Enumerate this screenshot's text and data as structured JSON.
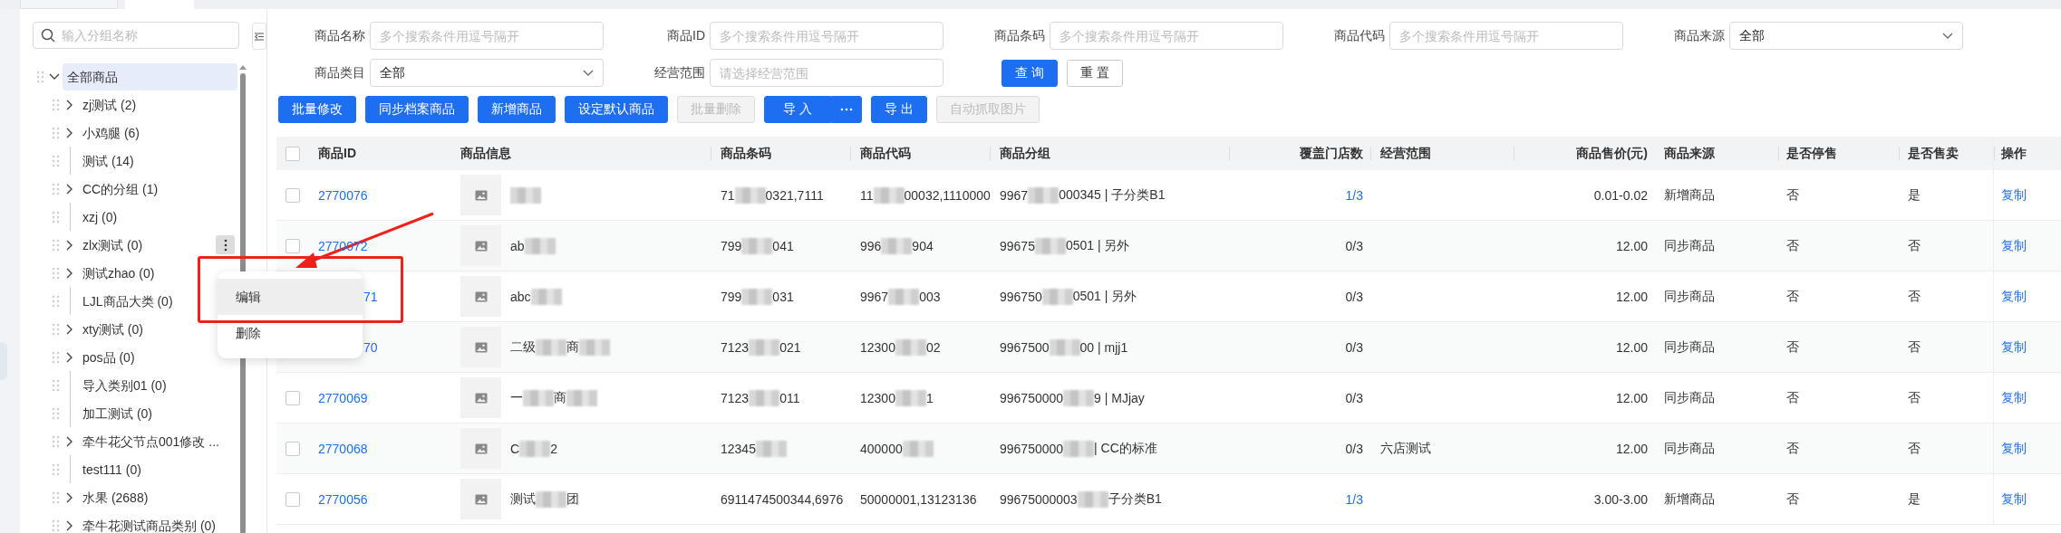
{
  "top_tabs": [
    {
      "selected": false
    },
    {
      "selected": true
    }
  ],
  "sidebar": {
    "search": {
      "placeholder": "输入分组名称"
    },
    "tree": [
      {
        "label": "全部商品",
        "kind": "group",
        "expanded": true,
        "selected": true,
        "menu_open": false,
        "children": [
          {
            "label": "zj测试 (2)",
            "kind": "group",
            "expanded": false,
            "selected": false,
            "menu_open": false
          },
          {
            "label": "小鸡腿 (6)",
            "kind": "group",
            "expanded": false,
            "selected": false,
            "menu_open": false
          },
          {
            "label": "测试 (14)",
            "kind": "leaf",
            "selected": false,
            "menu_open": false
          },
          {
            "label": "CC的分组 (1)",
            "kind": "group",
            "expanded": false,
            "selected": false,
            "menu_open": false
          },
          {
            "label": "xzj (0)",
            "kind": "leaf",
            "selected": false,
            "menu_open": false
          },
          {
            "label": "zlx测试 (0)",
            "kind": "group",
            "expanded": false,
            "selected": false,
            "menu_open": true
          },
          {
            "label": "测试zhao (0)",
            "kind": "group",
            "expanded": false,
            "selected": false,
            "menu_open": false
          },
          {
            "label": "LJL商品大类 (0)",
            "kind": "leaf",
            "selected": false,
            "menu_open": false
          },
          {
            "label": "xty测试 (0)",
            "kind": "group",
            "expanded": false,
            "selected": false,
            "menu_open": false
          },
          {
            "label": "pos品 (0)",
            "kind": "group",
            "expanded": false,
            "selected": false,
            "menu_open": false
          },
          {
            "label": "导入类别01 (0)",
            "kind": "leaf",
            "selected": false,
            "menu_open": false
          },
          {
            "label": "加工测试 (0)",
            "kind": "leaf",
            "selected": false,
            "menu_open": false
          },
          {
            "label": "牵牛花父节点001修改 ...",
            "kind": "group",
            "expanded": false,
            "selected": false,
            "menu_open": false
          },
          {
            "label": "test111 (0)",
            "kind": "leaf",
            "selected": false,
            "menu_open": false
          },
          {
            "label": "水果 (2688)",
            "kind": "group",
            "expanded": false,
            "selected": false,
            "menu_open": false
          },
          {
            "label": "牵牛花测试商品类别 (0)",
            "kind": "group",
            "expanded": false,
            "selected": false,
            "menu_open": false
          }
        ]
      }
    ],
    "context_menu": [
      {
        "label": "编辑",
        "hovered": true
      },
      {
        "label": "删除",
        "hovered": false
      }
    ]
  },
  "filter_rows": [
    [
      {
        "label": "商品名称",
        "kind": "input",
        "placeholder": "多个搜索条件用逗号隔开"
      },
      {
        "label": "商品ID",
        "kind": "input",
        "placeholder": "多个搜索条件用逗号隔开"
      },
      {
        "label": "商品条码",
        "kind": "input",
        "placeholder": "多个搜索条件用逗号隔开"
      },
      {
        "label": "商品代码",
        "kind": "input",
        "placeholder": "多个搜索条件用逗号隔开"
      },
      {
        "label": "商品来源",
        "kind": "select",
        "value": "全部"
      }
    ],
    [
      {
        "label": "商品类目",
        "kind": "select",
        "value": "全部"
      },
      {
        "label": "经营范围",
        "kind": "input",
        "placeholder": "请选择经营范围"
      }
    ]
  ],
  "filter_buttons": [
    {
      "label": "查 询",
      "kind": "primary"
    },
    {
      "label": "重 置",
      "kind": "default"
    }
  ],
  "toolbar": [
    {
      "label": "批量修改",
      "kind": "primary",
      "disabled": false
    },
    {
      "label": "同步档案商品",
      "kind": "primary",
      "disabled": false
    },
    {
      "label": "新增商品",
      "kind": "primary",
      "disabled": false
    },
    {
      "label": "设定默认商品",
      "kind": "primary",
      "disabled": false
    },
    {
      "label": "批量删除",
      "kind": "primary",
      "disabled": true
    },
    {
      "label": "导 入",
      "kind": "split",
      "disabled": false
    },
    {
      "label": "导 出",
      "kind": "primary",
      "disabled": false
    },
    {
      "label": "自动抓取图片",
      "kind": "primary",
      "disabled": true
    }
  ],
  "table": {
    "all_checked": false,
    "columns": [
      "商品ID",
      "商品信息",
      "商品条码",
      "商品代码",
      "商品分组",
      "覆盖门店数",
      "经营范围",
      "商品售价(元)",
      "商品来源",
      "是否停售",
      "是否售卖",
      "操作"
    ],
    "rows": [
      {
        "checked": false,
        "id": "2770076",
        "covered": false,
        "info": [
          {
            "kind": "blur"
          }
        ],
        "barcode": [
          {
            "kind": "text",
            "text": "71"
          },
          {
            "kind": "blur"
          },
          {
            "kind": "text",
            "text": "0321,7111"
          }
        ],
        "code": [
          {
            "kind": "text",
            "text": "11"
          },
          {
            "kind": "blur"
          },
          {
            "kind": "text",
            "text": "00032,1110000"
          }
        ],
        "group": [
          {
            "kind": "text",
            "text": "9967"
          },
          {
            "kind": "blur"
          },
          {
            "kind": "text",
            "text": "000345 | 子分类B1"
          }
        ],
        "stores": "1/3",
        "stores_link": true,
        "price": "0.01-0.02",
        "source": "新增商品",
        "stopped": "否",
        "on_sale": "是",
        "action": "复制"
      },
      {
        "checked": false,
        "id": "2770072",
        "covered": false,
        "info": [
          {
            "kind": "text",
            "text": "ab"
          },
          {
            "kind": "blur"
          }
        ],
        "barcode": [
          {
            "kind": "text",
            "text": "799"
          },
          {
            "kind": "blur"
          },
          {
            "kind": "text",
            "text": "041"
          }
        ],
        "code": [
          {
            "kind": "text",
            "text": "996"
          },
          {
            "kind": "blur"
          },
          {
            "kind": "text",
            "text": "904"
          }
        ],
        "group": [
          {
            "kind": "text",
            "text": "99675"
          },
          {
            "kind": "blur"
          },
          {
            "kind": "text",
            "text": "0501 | 另外"
          }
        ],
        "stores": "0/3",
        "stores_link": false,
        "price": "12.00",
        "source": "同步商品",
        "stopped": "否",
        "on_sale": "否",
        "action": "复制"
      },
      {
        "id": "71",
        "covered": true,
        "info": [
          {
            "kind": "text",
            "text": "abc"
          },
          {
            "kind": "blur"
          }
        ],
        "barcode": [
          {
            "kind": "text",
            "text": "799"
          },
          {
            "kind": "blur"
          },
          {
            "kind": "text",
            "text": "031"
          }
        ],
        "code": [
          {
            "kind": "text",
            "text": "9967"
          },
          {
            "kind": "blur"
          },
          {
            "kind": "text",
            "text": "003"
          }
        ],
        "group": [
          {
            "kind": "text",
            "text": "996750"
          },
          {
            "kind": "blur"
          },
          {
            "kind": "text",
            "text": "0501 | 另外"
          }
        ],
        "stores": "0/3",
        "stores_link": false,
        "price": "12.00",
        "source": "同步商品",
        "stopped": "否",
        "on_sale": "否",
        "action": "复制"
      },
      {
        "id": "70",
        "covered": true,
        "info": [
          {
            "kind": "text",
            "text": "二级"
          },
          {
            "kind": "blur"
          },
          {
            "kind": "text",
            "text": "商"
          },
          {
            "kind": "blur"
          }
        ],
        "barcode": [
          {
            "kind": "text",
            "text": "7123"
          },
          {
            "kind": "blur"
          },
          {
            "kind": "text",
            "text": "021"
          }
        ],
        "code": [
          {
            "kind": "text",
            "text": "12300"
          },
          {
            "kind": "blur"
          },
          {
            "kind": "text",
            "text": "02"
          }
        ],
        "group": [
          {
            "kind": "text",
            "text": "9967500"
          },
          {
            "kind": "blur"
          },
          {
            "kind": "text",
            "text": "00 | mjj1"
          }
        ],
        "stores": "0/3",
        "stores_link": false,
        "price": "12.00",
        "source": "同步商品",
        "stopped": "否",
        "on_sale": "否",
        "action": "复制"
      },
      {
        "checked": false,
        "id": "2770069",
        "covered": false,
        "info": [
          {
            "kind": "text",
            "text": "一"
          },
          {
            "kind": "blur"
          },
          {
            "kind": "text",
            "text": "商"
          },
          {
            "kind": "blur"
          }
        ],
        "barcode": [
          {
            "kind": "text",
            "text": "7123"
          },
          {
            "kind": "blur"
          },
          {
            "kind": "text",
            "text": "011"
          }
        ],
        "code": [
          {
            "kind": "text",
            "text": "12300"
          },
          {
            "kind": "blur"
          },
          {
            "kind": "text",
            "text": "1"
          }
        ],
        "group": [
          {
            "kind": "text",
            "text": "996750000"
          },
          {
            "kind": "blur"
          },
          {
            "kind": "text",
            "text": "9 | MJjay"
          }
        ],
        "stores": "0/3",
        "stores_link": false,
        "price": "12.00",
        "source": "同步商品",
        "stopped": "否",
        "on_sale": "否",
        "action": "复制"
      },
      {
        "checked": false,
        "id": "2770068",
        "covered": false,
        "info": [
          {
            "kind": "text",
            "text": "C"
          },
          {
            "kind": "blur"
          },
          {
            "kind": "text",
            "text": "2"
          }
        ],
        "barcode": [
          {
            "kind": "text",
            "text": "12345"
          },
          {
            "kind": "blur"
          }
        ],
        "code": [
          {
            "kind": "text",
            "text": "400000"
          },
          {
            "kind": "blur"
          }
        ],
        "group": [
          {
            "kind": "text",
            "text": "996750000"
          },
          {
            "kind": "blur"
          },
          {
            "kind": "text",
            "text": "| CC的标准"
          }
        ],
        "stores": "0/3",
        "stores_link": false,
        "scope": "六店测试",
        "price": "12.00",
        "source": "同步商品",
        "stopped": "否",
        "on_sale": "否",
        "action": "复制"
      },
      {
        "checked": false,
        "id": "2770056",
        "covered": false,
        "info": [
          {
            "kind": "text",
            "text": "测试"
          },
          {
            "kind": "blur"
          },
          {
            "kind": "text",
            "text": "团"
          }
        ],
        "barcode": [
          {
            "kind": "text",
            "text": "6911474500344,6976"
          }
        ],
        "code": [
          {
            "kind": "text",
            "text": "50000001,13123136"
          }
        ],
        "group": [
          {
            "kind": "text",
            "text": "99675000003"
          },
          {
            "kind": "blur"
          },
          {
            "kind": "text",
            "text": "子分类B1"
          }
        ],
        "stores": "1/3",
        "stores_link": true,
        "price": "3.00-3.00",
        "source": "新增商品",
        "stopped": "否",
        "on_sale": "是",
        "action": "复制"
      }
    ]
  }
}
